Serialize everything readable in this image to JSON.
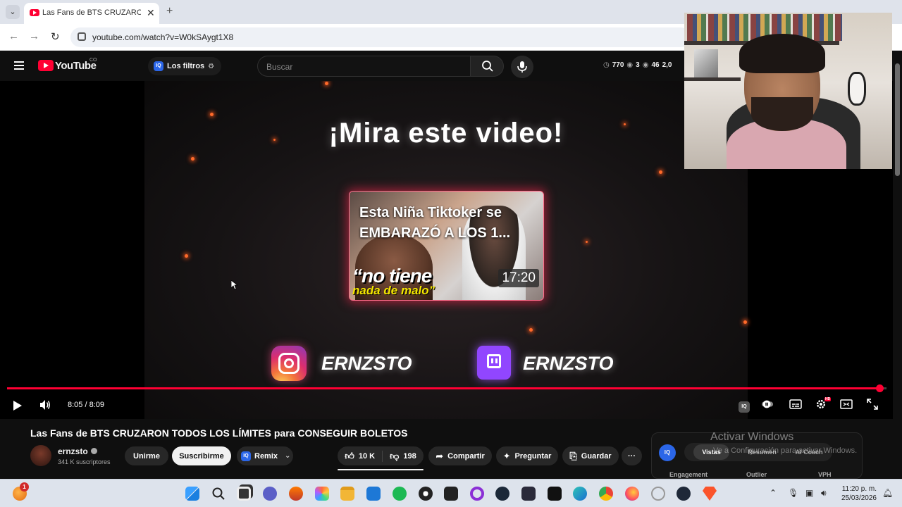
{
  "browser": {
    "tab_title": "Las Fans de BTS CRUZARON TO",
    "url": "youtube.com/watch?v=W0kSAygt1X8",
    "new_tab": "+",
    "tab_close": "✕"
  },
  "masthead": {
    "logo_text": "YouTube",
    "country": "CO",
    "filters_label": "Los filtros",
    "iq_badge": "IQ",
    "search_placeholder": "Buscar",
    "stats": {
      "views": "770",
      "eye1": "3",
      "eye2": "46",
      "more": "2,0"
    }
  },
  "endscreen": {
    "headline": "¡Mira este video!",
    "thumb_title": "Esta Niña Tiktoker se\nEMBARAZÓ A LOS 1...",
    "thumb_quote_line1": "“no tiene",
    "thumb_quote_line2": "nada de malo”",
    "thumb_duration": "17:20",
    "instagram_handle": "ERNZSTO",
    "twitch_handle": "ERNZSTO"
  },
  "player": {
    "time": "8:05 / 8:09",
    "progress": 0.9918,
    "quality_badge": "HD"
  },
  "video": {
    "title": "Las Fans de BTS CRUZARON TODOS LOS LÍMITES para CONSEGUIR BOLETOS",
    "channel": "ernzsto",
    "subscribers": "341 K suscriptores",
    "join_label": "Unirme",
    "subscribe_label": "Suscribirme",
    "remix_label": "Remix",
    "likes": "10 K",
    "dislikes": "198",
    "share_label": "Compartir",
    "ask_label": "Preguntar",
    "save_label": "Guardar",
    "more_label": "···"
  },
  "iq_panel": {
    "logo": "IQ",
    "tab_views": "Vistas",
    "tab_summary": "Resumen",
    "tab_ai": "AI Coach",
    "col_engagement": "Engagement",
    "col_outlier": "Outlier",
    "col_vph": "VPH"
  },
  "windows_watermark": {
    "title": "Activar Windows",
    "subtitle": "Ve a Configuración para activar Windows."
  },
  "taskbar": {
    "notification_count": "1",
    "time": "11:20 p. m.",
    "date": "25/03/2026"
  },
  "colors": {
    "accent": "#ff0033",
    "twitch": "#9146ff",
    "iq": "#2b66e8"
  }
}
